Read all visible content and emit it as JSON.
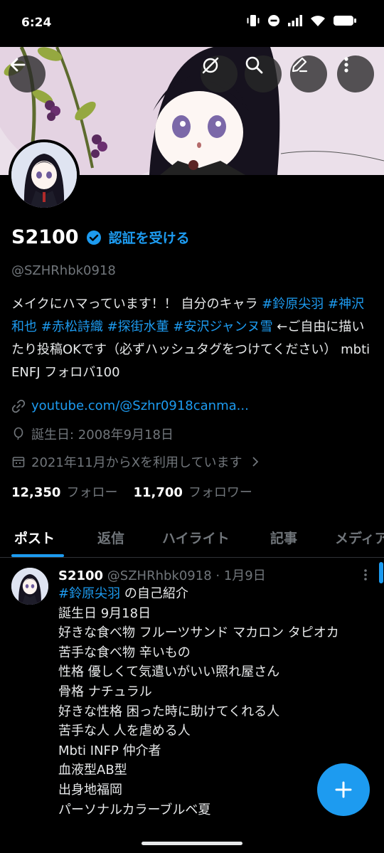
{
  "status_bar": {
    "time": "6:24"
  },
  "header": {
    "back_icon": "arrow-left-icon",
    "actions": [
      "grok-icon",
      "search-icon",
      "edit-icon",
      "more-icon"
    ]
  },
  "profile": {
    "name": "S2100",
    "verify_cta": "認証を受ける",
    "handle": "@SZHRhbk0918",
    "bio": {
      "p1": "メイクにハマっています！！ 自分のキャラ ",
      "tags1": [
        "#鈴原尖羽",
        "#神沢和也",
        "#赤松詩織",
        "#探街水董",
        "#安沢ジャンヌ雪"
      ],
      "p2": " ←ご自由に描いたり投稿OKです（必ずハッシュタグをつけてください） mbti ENFJ フォロバ100"
    },
    "link": "youtube.com/@Szhr0918canma...",
    "birthday": "誕生日: 2008年9月18日",
    "joined": "2021年11月からXを利用しています",
    "following_count": "12,350",
    "following_label": "フォロー",
    "followers_count": "11,700",
    "followers_label": "フォロワー"
  },
  "tabs": [
    "ポスト",
    "返信",
    "ハイライト",
    "記事",
    "メディア"
  ],
  "post": {
    "name": "S2100",
    "handle": "@SZHRhbk0918",
    "date": "1月9日",
    "tag": "#鈴原尖羽",
    "tag_suffix": " の自己紹介",
    "lines": [
      "誕生日 9月18日",
      "好きな食べ物 フルーツサンド マカロン タピオカ",
      "苦手な食べ物 辛いもの",
      "性格 優しくて気遣いがいい照れ屋さん",
      "骨格 ナチュラル",
      "好きな性格 困った時に助けてくれる人",
      "苦手な人 人を虐める人",
      "Mbti INFP 仲介者",
      "血液型AB型",
      "出身地福岡",
      "パーソナルカラーブルベ夏"
    ]
  },
  "fab": {
    "icon": "plus-icon"
  },
  "colors": {
    "accent": "#1d9bf0",
    "background": "#000000",
    "muted": "#71767b"
  }
}
